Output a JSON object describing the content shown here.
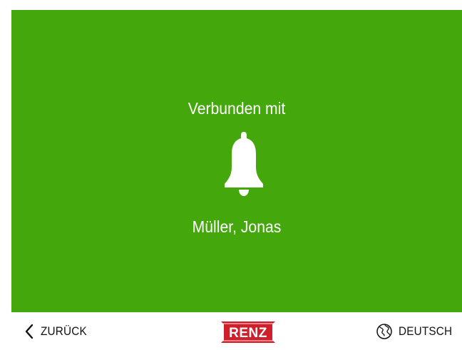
{
  "status": {
    "title": "Verbunden mit",
    "contact_name": "Müller, Jonas",
    "icon": "bell-icon",
    "background_color": "#44a80c"
  },
  "footer": {
    "back_label": "ZURÜCK",
    "back_icon": "chevron-left-icon",
    "logo_text": "RENZ",
    "logo_color": "#cf1f2a",
    "language_label": "DEUTSCH",
    "language_icon": "globe-icon"
  }
}
